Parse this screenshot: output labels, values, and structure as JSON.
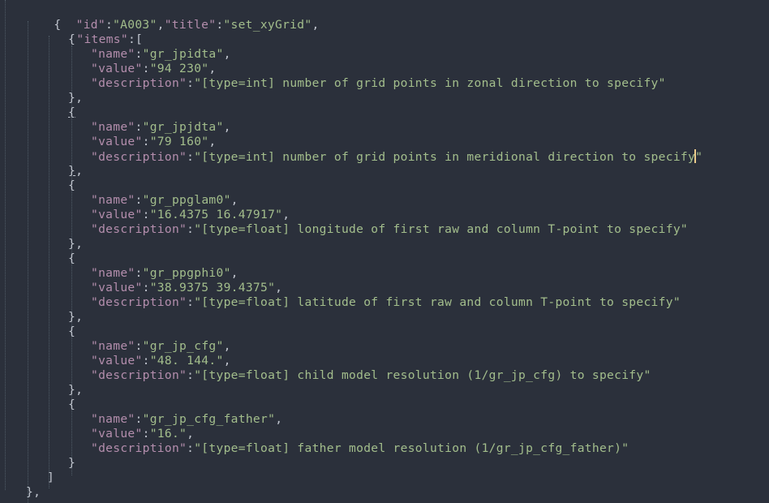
{
  "editor": {
    "colors": {
      "background": "#2b303b",
      "key": "#b48ead",
      "string": "#a3be8c",
      "punctuation": "#c0c5ce",
      "caret": "#ebcb8b"
    },
    "header": {
      "id_key": "\"id\"",
      "id_value": "\"A003\"",
      "title_key": "\"title\"",
      "title_value": "\"set_xyGrid\"",
      "items_key": "\"items\""
    },
    "items": [
      {
        "name_key": "\"name\"",
        "name": "\"gr_jpidta\"",
        "value_key": "\"value\"",
        "value": "\"94 230\"",
        "desc_key": "\"description\"",
        "description": "\"[type=int] number of grid points in zonal direction to specify\""
      },
      {
        "name_key": "\"name\"",
        "name": "\"gr_jpjdta\"",
        "value_key": "\"value\"",
        "value": "\"79 160\"",
        "desc_key": "\"description\"",
        "description_pre_caret": "\"[type=int] number of grid points in meridional direction to specify",
        "description_post_caret": "\""
      },
      {
        "name_key": "\"name\"",
        "name": "\"gr_ppglam0\"",
        "value_key": "\"value\"",
        "value": "\"16.4375 16.47917\"",
        "desc_key": "\"description\"",
        "description": "\"[type=float] longitude of first raw and column T-point to specify\""
      },
      {
        "name_key": "\"name\"",
        "name": "\"gr_ppgphi0\"",
        "value_key": "\"value\"",
        "value": "\"38.9375 39.4375\"",
        "desc_key": "\"description\"",
        "description": "\"[type=float] latitude of first raw and column T-point to specify\""
      },
      {
        "name_key": "\"name\"",
        "name": "\"gr_jp_cfg\"",
        "value_key": "\"value\"",
        "value": "\"48. 144.\"",
        "desc_key": "\"description\"",
        "description": "\"[type=float] child model resolution (1/gr_jp_cfg) to specify\""
      },
      {
        "name_key": "\"name\"",
        "name": "\"gr_jp_cfg_father\"",
        "value_key": "\"value\"",
        "value": "\"16.\"",
        "desc_key": "\"description\"",
        "description": "\"[type=float] father model resolution (1/gr_jp_cfg_father)\""
      }
    ]
  }
}
